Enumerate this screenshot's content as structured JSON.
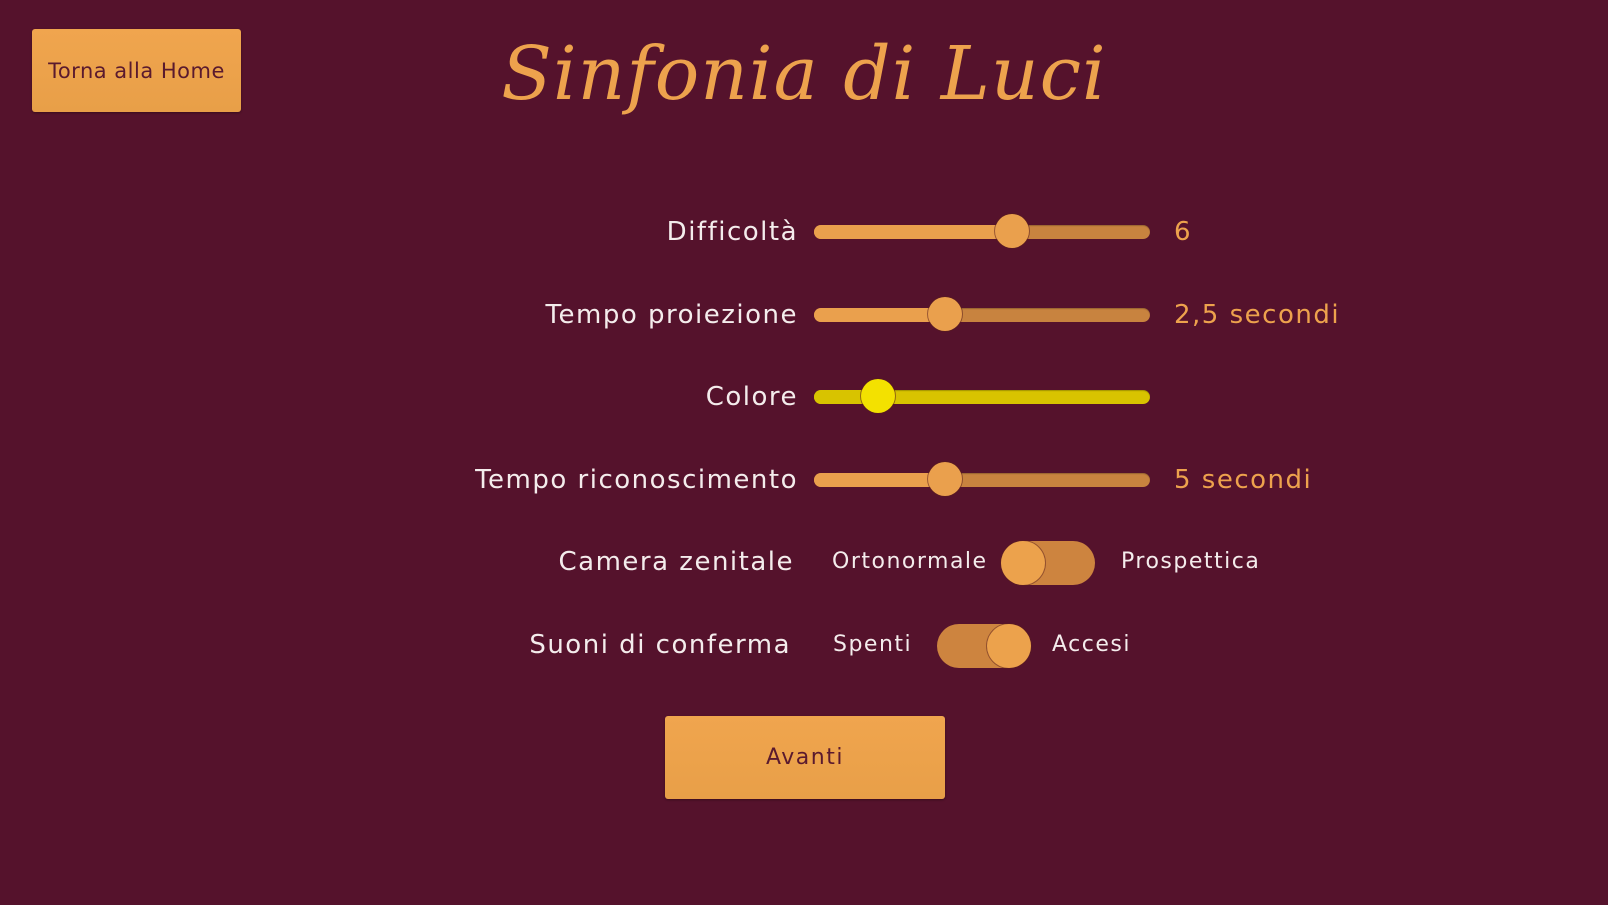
{
  "header": {
    "home_button": "Torna alla Home",
    "title": "Sinfonia di Luci"
  },
  "settings": {
    "difficulty": {
      "label": "Difficoltà",
      "value": "6",
      "level": 0.59
    },
    "projection_time": {
      "label": "Tempo proiezione",
      "value": "2,5 secondi",
      "level": 0.39
    },
    "color": {
      "label": "Colore",
      "level": 0.19,
      "color": "#f3e100"
    },
    "recognition_time": {
      "label": "Tempo riconoscimento",
      "value": "5 secondi",
      "level": 0.39
    },
    "camera": {
      "label": "Camera zenitale",
      "off_label": "Ortonormale",
      "on_label": "Prospettica",
      "on": false
    },
    "sounds": {
      "label": "Suoni di conferma",
      "off_label": "Spenti",
      "on_label": "Accesi",
      "on": true
    }
  },
  "footer": {
    "next_button": "Avanti"
  },
  "colors": {
    "background": "#55122c",
    "accent": "#eda24d",
    "text": "#f4ecec"
  }
}
